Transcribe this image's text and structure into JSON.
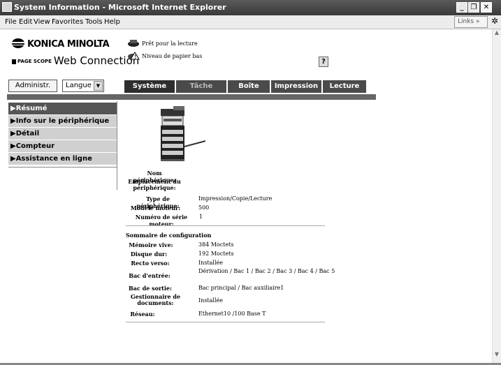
{
  "window": {
    "title": "System Information - Microsoft Internet Explorer"
  },
  "menubar": {
    "items": [
      "File",
      "Edit",
      "View",
      "Favorites",
      "Tools",
      "Help"
    ],
    "links_label": "Links"
  },
  "header": {
    "brand": "KONICA MINOLTA",
    "product_prefix": "PAGE SCOPE",
    "product": "Web Connection",
    "status_ready": "Prêt pour la lecture",
    "status_paper": "Niveau de papier bas",
    "help_label": "?"
  },
  "toolbar": {
    "admin_label": "Administr.",
    "language_label": "Langue"
  },
  "tabs": [
    {
      "label": "Système"
    },
    {
      "label": "Tâche"
    },
    {
      "label": "Boîte"
    },
    {
      "label": "Impression"
    },
    {
      "label": "Lecture"
    }
  ],
  "sidebar": {
    "items": [
      {
        "label": "▶Résumé"
      },
      {
        "label": "▶Info sur le périphérique"
      },
      {
        "label": "▶Détail"
      },
      {
        "label": "▶Compteur"
      },
      {
        "label": "▶Assistance en ligne"
      }
    ]
  },
  "device": {
    "name_label": "Nom périphérique:",
    "location_label": "Emplacement du périphérique:",
    "type_label": "Type de périphérique:",
    "type_value": "Impression/Copie/Lecture",
    "engine_model_label": "Modèle moteur:",
    "engine_model_value": "500",
    "serial_label": "Numéro de série moteur:",
    "serial_value": "1"
  },
  "config": {
    "title": "Sommaire de configuration",
    "ram_label": "Mémoire vive:",
    "ram_value": "384 Moctets",
    "hdd_label": "Disque dur:",
    "hdd_value": "192 Moctets",
    "duplex_label": "Recto verso:",
    "duplex_value": "Installée",
    "input_label": "Bac d'entrée:",
    "input_value": "Dérivation / Bac 1 / Bac 2 / Bac 3 / Bac 4 / Bac 5",
    "output_label": "Bac de sortie:",
    "output_value": "Bac principal / Bac auxiliaire1",
    "docmgr_label": "Gestionnaire de documents:",
    "docmgr_value": "Installée",
    "network_label": "Réseau:",
    "network_value": "Ethernet10 /100 Base T"
  }
}
